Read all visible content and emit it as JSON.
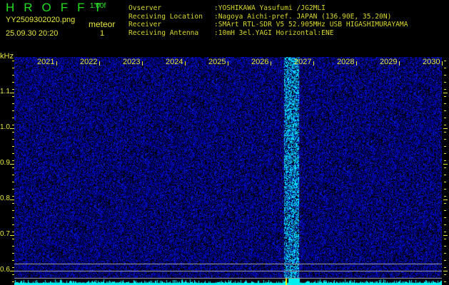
{
  "header": {
    "title": "HROFFT",
    "version": "1.00f",
    "filename": "YY2509302020.png",
    "datetime": "25.09.30 20:20",
    "event_label": "meteor",
    "event_count": "1"
  },
  "station_info": [
    {
      "key": "Ovserver",
      "value": ":YOSHIKAWA Yasufumi /JG2MLI"
    },
    {
      "key": "Receiving Location",
      "value": ":Nagoya Aichi-pref. JAPAN (136.90E, 35.20N)"
    },
    {
      "key": "Receiver",
      "value": ":SMArt RTL-SDR V5 52.905MHz USB HIGASHIMURAYAMA"
    },
    {
      "key": "Receiving Antenna",
      "value": ":10mH 3el.YAGI Horizontal:ENE"
    }
  ],
  "axis": {
    "y_unit": "kHz",
    "y_ticks": [
      "1.1",
      "1.0",
      "0.9",
      "0.8",
      "0.7",
      "0.6"
    ],
    "x_ticks": [
      "2021",
      "2022",
      "2023",
      "2024",
      "2025",
      "2026",
      "2027",
      "2028",
      "2029",
      "2030"
    ]
  },
  "colors": {
    "noise": "#1010c0",
    "signal": "#40c0ff",
    "spectrum": "#00f0f0",
    "label": "#e8e840"
  }
}
